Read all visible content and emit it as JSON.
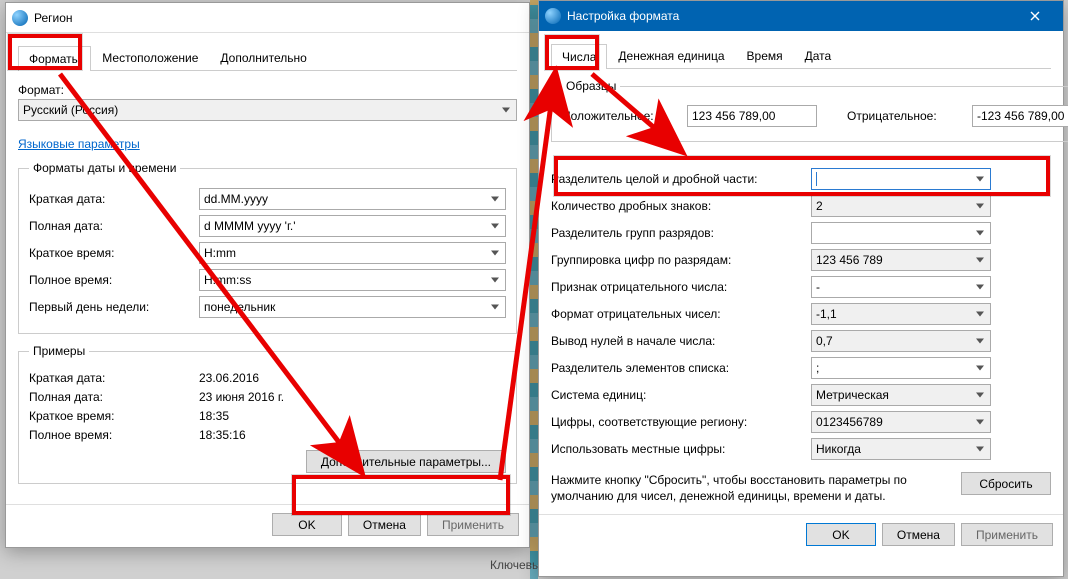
{
  "region": {
    "title": "Регион",
    "tabs": {
      "formats": "Форматы",
      "location": "Местоположение",
      "advanced": "Дополнительно"
    },
    "format_label": "Формат:",
    "format_value": "Русский (Россия)",
    "lang_prefs": "Языковые параметры",
    "dt_group": "Форматы даты и времени",
    "rows": {
      "short_date_l": "Краткая дата:",
      "short_date_v": "dd.MM.yyyy",
      "long_date_l": "Полная дата:",
      "long_date_v": "d MMMM yyyy 'г.'",
      "short_time_l": "Краткое время:",
      "short_time_v": "H:mm",
      "long_time_l": "Полное время:",
      "long_time_v": "H:mm:ss",
      "first_dow_l": "Первый день недели:",
      "first_dow_v": "понедельник"
    },
    "examples_group": "Примеры",
    "examples": {
      "short_date_l": "Краткая дата:",
      "short_date_v": "23.06.2016",
      "long_date_l": "Полная дата:",
      "long_date_v": "23 июня 2016 г.",
      "short_time_l": "Краткое время:",
      "short_time_v": "18:35",
      "long_time_l": "Полное время:",
      "long_time_v": "18:35:16"
    },
    "more_btn": "Дополнительные параметры...",
    "ok": "OK",
    "cancel": "Отмена",
    "apply": "Применить",
    "stray": "Ключевы"
  },
  "fmt": {
    "title": "Настройка формата",
    "tabs": {
      "numbers": "Числа",
      "currency": "Денежная единица",
      "time": "Время",
      "date": "Дата"
    },
    "samples_group": "Образцы",
    "pos_label": "Положительное:",
    "pos_value": "123 456 789,00",
    "neg_label": "Отрицательное:",
    "neg_value": "-123 456 789,00",
    "rows": {
      "decimal_sep_l": "Разделитель целой и дробной части:",
      "decimal_sep_v": "",
      "decimals_l": "Количество дробных знаков:",
      "decimals_v": "2",
      "group_sep_l": "Разделитель групп разрядов:",
      "group_sep_v": "",
      "grouping_l": "Группировка цифр по разрядам:",
      "grouping_v": "123 456 789",
      "neg_sign_l": "Признак отрицательного числа:",
      "neg_sign_v": "-",
      "neg_fmt_l": "Формат отрицательных чисел:",
      "neg_fmt_v": "-1,1",
      "lead_zero_l": "Вывод нулей в начале числа:",
      "lead_zero_v": "0,7",
      "list_sep_l": "Разделитель элементов списка:",
      "list_sep_v": ";",
      "measure_l": "Система единиц:",
      "measure_v": "Метрическая",
      "native_l": "Цифры, соответствующие региону:",
      "native_v": "0123456789",
      "use_native_l": "Использовать местные цифры:",
      "use_native_v": "Никогда"
    },
    "reset_hint": "Нажмите кнопку \"Сбросить\", чтобы восстановить параметры по умолчанию для чисел, денежной единицы, времени и даты.",
    "reset": "Сбросить",
    "ok": "OK",
    "cancel": "Отмена",
    "apply": "Применить"
  }
}
